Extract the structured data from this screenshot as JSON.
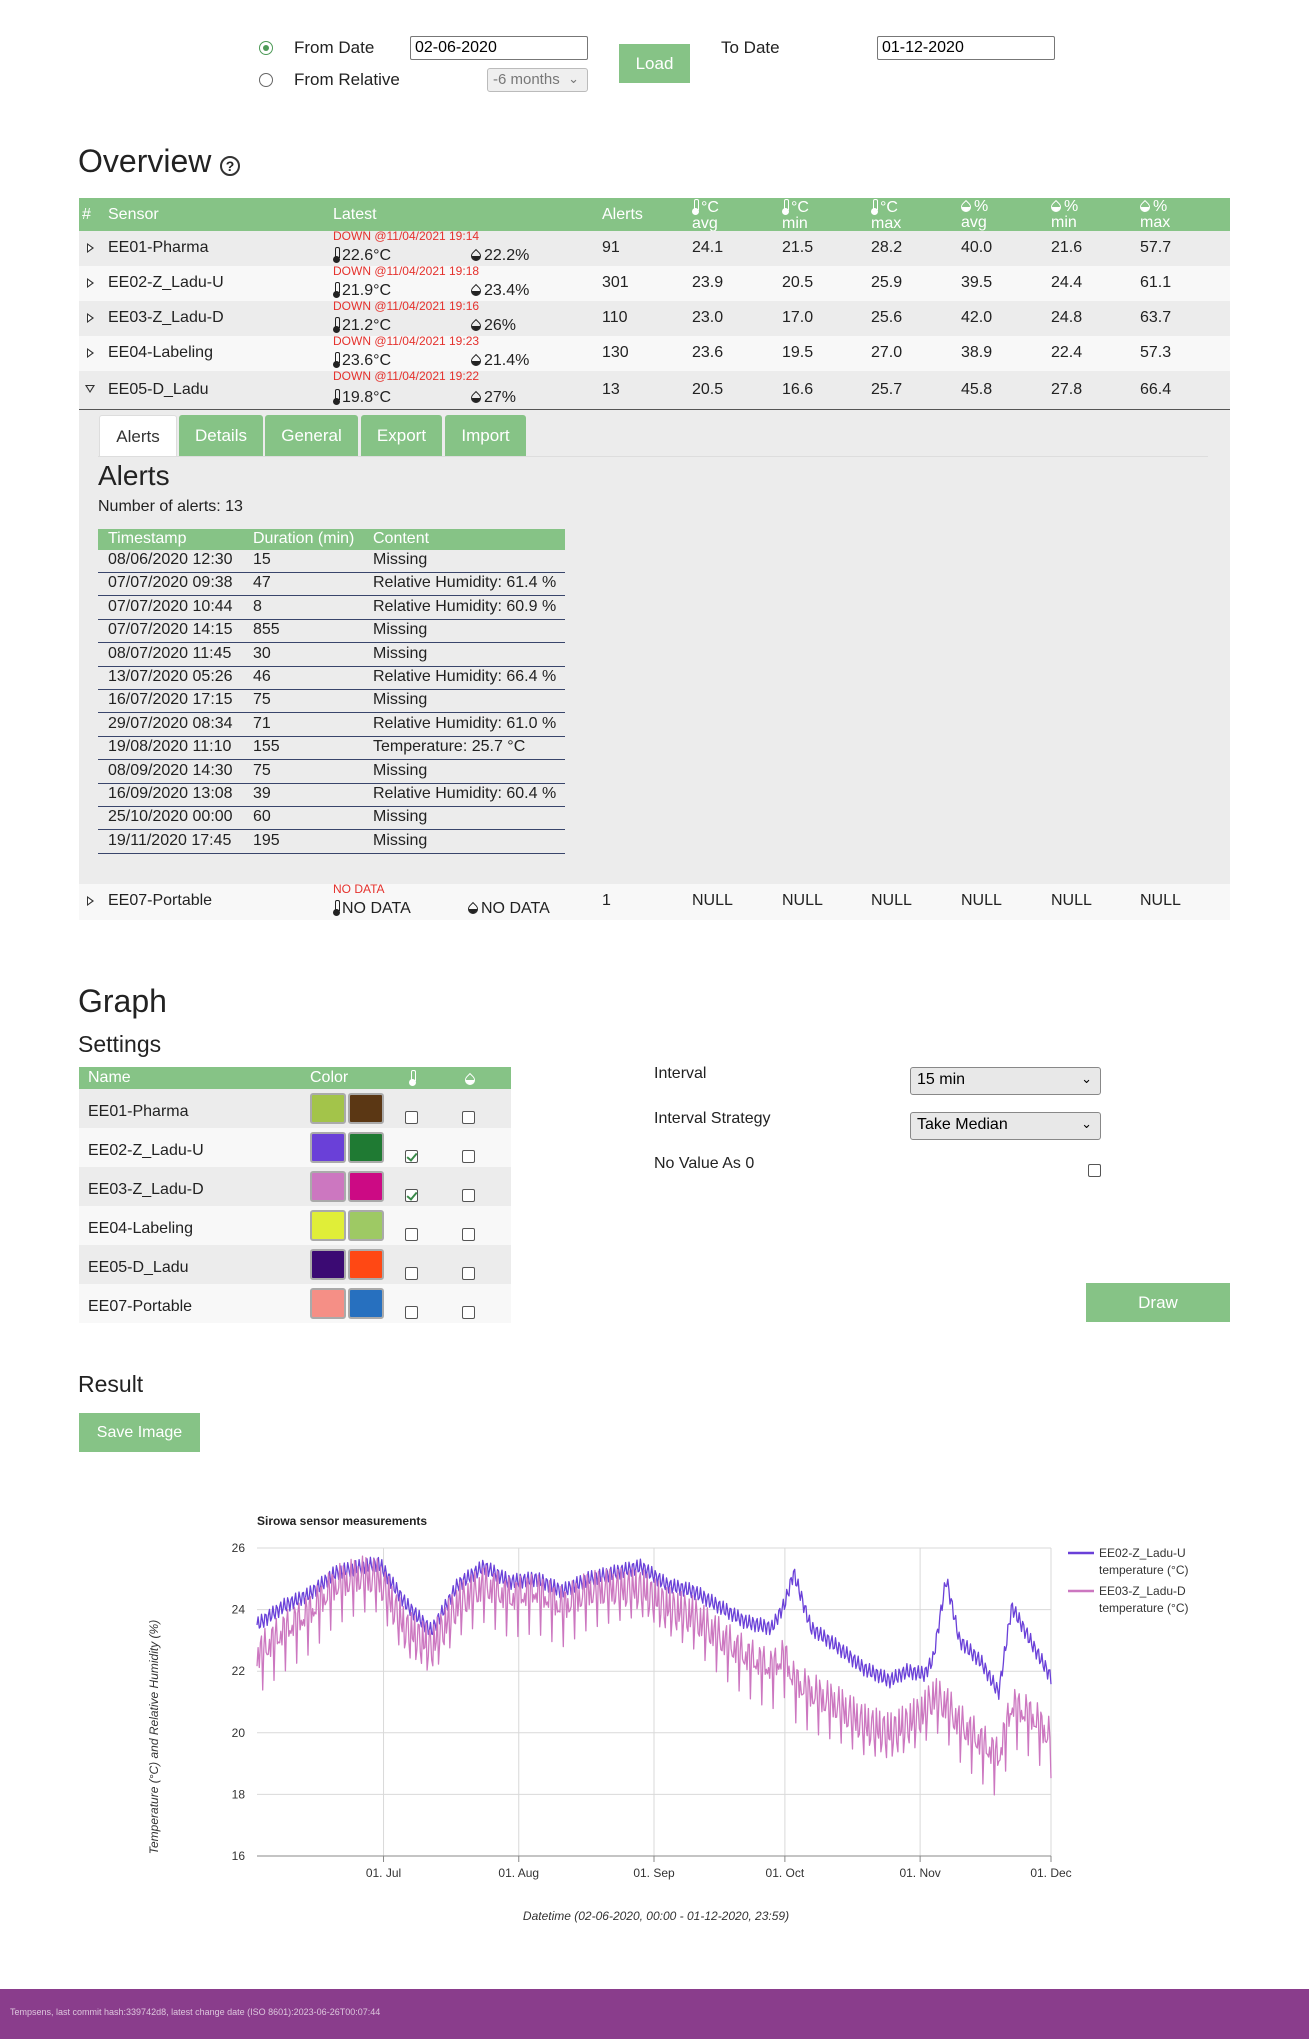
{
  "controls": {
    "from_date_label": "From Date",
    "from_date_value": "02-06-2020",
    "from_relative_label": "From Relative",
    "relative_value": "-6 months",
    "load_label": "Load",
    "to_date_label": "To Date",
    "to_date_value": "01-12-2020"
  },
  "overview": {
    "title": "Overview",
    "help_icon": "?",
    "headers": {
      "num": "#",
      "sensor": "Sensor",
      "latest": "Latest",
      "alerts": "Alerts",
      "t_avg_u": "°C",
      "t_avg": "avg",
      "t_min_u": "°C",
      "t_min": "min",
      "t_max_u": "°C",
      "t_max": "max",
      "h_avg_u": "%",
      "h_avg": "avg",
      "h_min_u": "%",
      "h_min": "min",
      "h_max_u": "%",
      "h_max": "max"
    },
    "rows": [
      {
        "name": "EE01-Pharma",
        "status": "DOWN @11/04/2021 19:14",
        "temp": "22.6°C",
        "hum": "22.2%",
        "alerts": "91",
        "tavg": "24.1",
        "tmin": "21.5",
        "tmax": "28.2",
        "havg": "40.0",
        "hmin": "21.6",
        "hmax": "57.7"
      },
      {
        "name": "EE02-Z_Ladu-U",
        "status": "DOWN @11/04/2021 19:18",
        "temp": "21.9°C",
        "hum": "23.4%",
        "alerts": "301",
        "tavg": "23.9",
        "tmin": "20.5",
        "tmax": "25.9",
        "havg": "39.5",
        "hmin": "24.4",
        "hmax": "61.1"
      },
      {
        "name": "EE03-Z_Ladu-D",
        "status": "DOWN @11/04/2021 19:16",
        "temp": "21.2°C",
        "hum": "26%",
        "alerts": "110",
        "tavg": "23.0",
        "tmin": "17.0",
        "tmax": "25.6",
        "havg": "42.0",
        "hmin": "24.8",
        "hmax": "63.7"
      },
      {
        "name": "EE04-Labeling",
        "status": "DOWN @11/04/2021 19:23",
        "temp": "23.6°C",
        "hum": "21.4%",
        "alerts": "130",
        "tavg": "23.6",
        "tmin": "19.5",
        "tmax": "27.0",
        "havg": "38.9",
        "hmin": "22.4",
        "hmax": "57.3"
      },
      {
        "name": "EE05-D_Ladu",
        "status": "DOWN @11/04/2021 19:22",
        "temp": "19.8°C",
        "hum": "27%",
        "alerts": "13",
        "tavg": "20.5",
        "tmin": "16.6",
        "tmax": "25.7",
        "havg": "45.8",
        "hmin": "27.8",
        "hmax": "66.4"
      },
      {
        "name": "EE07-Portable",
        "status": "NO DATA",
        "temp": "NO DATA",
        "hum": "NO DATA",
        "alerts": "1",
        "tavg": "NULL",
        "tmin": "NULL",
        "tmax": "NULL",
        "havg": "NULL",
        "hmin": "NULL",
        "hmax": "NULL"
      }
    ],
    "tabs": [
      "Alerts",
      "Details",
      "General",
      "Export",
      "Import"
    ],
    "alerts_title": "Alerts",
    "alerts_count": "Number of alerts: 13",
    "alert_headers": {
      "timestamp": "Timestamp",
      "duration": "Duration (min)",
      "content": "Content"
    },
    "alert_rows": [
      {
        "ts": "08/06/2020 12:30",
        "dur": "15",
        "content": "Missing"
      },
      {
        "ts": "07/07/2020 09:38",
        "dur": "47",
        "content": "Relative Humidity: 61.4 %"
      },
      {
        "ts": "07/07/2020 10:44",
        "dur": "8",
        "content": "Relative Humidity: 60.9 %"
      },
      {
        "ts": "07/07/2020 14:15",
        "dur": "855",
        "content": "Missing"
      },
      {
        "ts": "08/07/2020 11:45",
        "dur": "30",
        "content": "Missing"
      },
      {
        "ts": "13/07/2020 05:26",
        "dur": "46",
        "content": "Relative Humidity: 66.4 %"
      },
      {
        "ts": "16/07/2020 17:15",
        "dur": "75",
        "content": "Missing"
      },
      {
        "ts": "29/07/2020 08:34",
        "dur": "71",
        "content": "Relative Humidity: 61.0 %"
      },
      {
        "ts": "19/08/2020 11:10",
        "dur": "155",
        "content": "Temperature: 25.7 °C"
      },
      {
        "ts": "08/09/2020 14:30",
        "dur": "75",
        "content": "Missing"
      },
      {
        "ts": "16/09/2020 13:08",
        "dur": "39",
        "content": "Relative Humidity: 60.4 %"
      },
      {
        "ts": "25/10/2020 00:00",
        "dur": "60",
        "content": "Missing"
      },
      {
        "ts": "19/11/2020 17:45",
        "dur": "195",
        "content": "Missing"
      }
    ]
  },
  "graph": {
    "title": "Graph",
    "settings_title": "Settings",
    "headers": {
      "name": "Name",
      "color": "Color"
    },
    "sensors": [
      {
        "name": "EE01-Pharma",
        "temp_color": "#a3c44a",
        "hum_color": "#5b3714",
        "temp_checked": false,
        "hum_checked": false
      },
      {
        "name": "EE02-Z_Ladu-U",
        "temp_color": "#6a40d8",
        "hum_color": "#1f7a33",
        "temp_checked": true,
        "hum_checked": false
      },
      {
        "name": "EE03-Z_Ladu-D",
        "temp_color": "#cc77c0",
        "hum_color": "#cc0a84",
        "temp_checked": true,
        "hum_checked": false
      },
      {
        "name": "EE04-Labeling",
        "temp_color": "#e0ee38",
        "hum_color": "#9ec964",
        "temp_checked": false,
        "hum_checked": false
      },
      {
        "name": "EE05-D_Ladu",
        "temp_color": "#3b0a73",
        "hum_color": "#ff4814",
        "temp_checked": false,
        "hum_checked": false
      },
      {
        "name": "EE07-Portable",
        "temp_color": "#f58f86",
        "hum_color": "#2770bf",
        "temp_checked": false,
        "hum_checked": false
      }
    ],
    "interval_label": "Interval",
    "interval_value": "15 min",
    "strategy_label": "Interval Strategy",
    "strategy_value": "Take Median",
    "novalue_label": "No Value As 0",
    "draw_label": "Draw",
    "result_title": "Result",
    "save_label": "Save Image"
  },
  "chart_data": {
    "type": "line",
    "title": "Sirowa sensor measurements",
    "xlabel": "Datetime (02-06-2020, 00:00 - 01-12-2020, 23:59)",
    "ylabel": "Temperature (°C) and Relative Humidity (%)",
    "xlim": [
      "2020-06-02",
      "2020-12-01"
    ],
    "ylim": [
      16,
      26
    ],
    "yticks": [
      "16",
      "18",
      "20",
      "22",
      "24",
      "26"
    ],
    "xticks": [
      {
        "date": "2020-07-01",
        "label": "01. Jul"
      },
      {
        "date": "2020-08-01",
        "label": "01. Aug"
      },
      {
        "date": "2020-09-01",
        "label": "01. Sep"
      },
      {
        "date": "2020-10-01",
        "label": "01. Oct"
      },
      {
        "date": "2020-11-01",
        "label": "01. Nov"
      },
      {
        "date": "2020-12-01",
        "label": "01. Dec"
      }
    ],
    "grid": true,
    "legend_position": "right",
    "series": [
      {
        "name": "EE02-Z_Ladu-U temperature (°C)",
        "color": "#6a40d8",
        "x": [
          "2020-06-02",
          "2020-06-08",
          "2020-06-14",
          "2020-06-20",
          "2020-06-26",
          "2020-06-30",
          "2020-07-06",
          "2020-07-12",
          "2020-07-18",
          "2020-07-24",
          "2020-07-30",
          "2020-08-05",
          "2020-08-11",
          "2020-08-17",
          "2020-08-23",
          "2020-08-29",
          "2020-09-04",
          "2020-09-10",
          "2020-09-16",
          "2020-09-22",
          "2020-09-28",
          "2020-10-01",
          "2020-10-03",
          "2020-10-07",
          "2020-10-13",
          "2020-10-19",
          "2020-10-25",
          "2020-10-29",
          "2020-11-02",
          "2020-11-04",
          "2020-11-07",
          "2020-11-10",
          "2020-11-15",
          "2020-11-19",
          "2020-11-22",
          "2020-11-27",
          "2020-12-01"
        ],
        "y": [
          23.5,
          24.1,
          24.5,
          25.2,
          25.4,
          25.5,
          24.2,
          23.3,
          24.8,
          25.4,
          24.9,
          25.0,
          24.6,
          25.0,
          25.2,
          25.4,
          24.8,
          24.6,
          24.1,
          23.6,
          23.4,
          24.2,
          25.2,
          23.4,
          22.8,
          22.1,
          21.7,
          22.0,
          21.9,
          22.4,
          25.0,
          23.0,
          22.3,
          21.3,
          24.1,
          22.8,
          21.8
        ]
      },
      {
        "name": "EE03-Z_Ladu-D temperature (°C)",
        "color": "#cc77c0",
        "x": [
          "2020-06-02",
          "2020-06-08",
          "2020-06-14",
          "2020-06-20",
          "2020-06-26",
          "2020-06-30",
          "2020-07-06",
          "2020-07-12",
          "2020-07-18",
          "2020-07-24",
          "2020-07-30",
          "2020-08-05",
          "2020-08-11",
          "2020-08-17",
          "2020-08-23",
          "2020-08-29",
          "2020-09-04",
          "2020-09-10",
          "2020-09-16",
          "2020-09-22",
          "2020-09-28",
          "2020-10-01",
          "2020-10-03",
          "2020-10-07",
          "2020-10-13",
          "2020-10-19",
          "2020-10-25",
          "2020-10-29",
          "2020-11-02",
          "2020-11-04",
          "2020-11-07",
          "2020-11-10",
          "2020-11-15",
          "2020-11-19",
          "2020-11-22",
          "2020-11-27",
          "2020-12-01"
        ],
        "y": [
          22.6,
          23.4,
          24.0,
          24.9,
          25.2,
          25.1,
          23.5,
          22.9,
          24.3,
          24.9,
          24.5,
          24.7,
          24.2,
          24.7,
          24.8,
          24.8,
          24.2,
          23.9,
          23.2,
          22.6,
          22.2,
          22.6,
          21.8,
          21.4,
          21.0,
          20.4,
          20.1,
          20.4,
          20.8,
          21.3,
          21.0,
          20.4,
          19.8,
          19.3,
          21.0,
          20.6,
          19.9
        ]
      }
    ]
  },
  "footer": {
    "text": "Tempsens, last commit hash:339742d8, latest change date (ISO 8601):2023-06-26T00:07:44"
  }
}
